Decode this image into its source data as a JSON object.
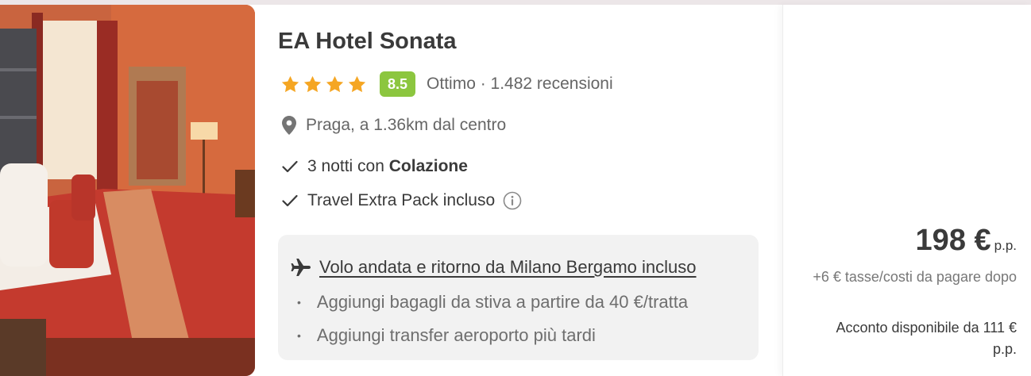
{
  "hotel": {
    "name": "EA Hotel Sonata",
    "stars": 4,
    "score": "8.5",
    "rating_text": "Ottimo · 1.482 recensioni",
    "location": "Praga, a 1.36km dal centro",
    "nights_prefix": "3 notti con",
    "board": "Colazione",
    "extra_pack": "Travel Extra Pack incluso"
  },
  "flight": {
    "main": "Volo andata e ritorno da Milano Bergamo incluso",
    "addons": [
      "Aggiungi bagagli da stiva a partire da 40 €/tratta",
      "Aggiungi transfer aeroporto più tardi"
    ]
  },
  "price": {
    "amount": "198 €",
    "unit": "p.p.",
    "taxes": "+6 € tasse/costi da pagare dopo",
    "deposit": "Acconto disponibile da 111 € p.p."
  },
  "colors": {
    "star": "#f5a623",
    "score_badge": "#8cc63f",
    "text": "#3a3a3a",
    "muted": "#666666",
    "flight_box": "#f2f2f2"
  },
  "icons": {
    "star": "star-icon",
    "location": "map-pin-icon",
    "check": "check-icon",
    "info": "info-circle-icon",
    "plane": "airplane-icon"
  }
}
